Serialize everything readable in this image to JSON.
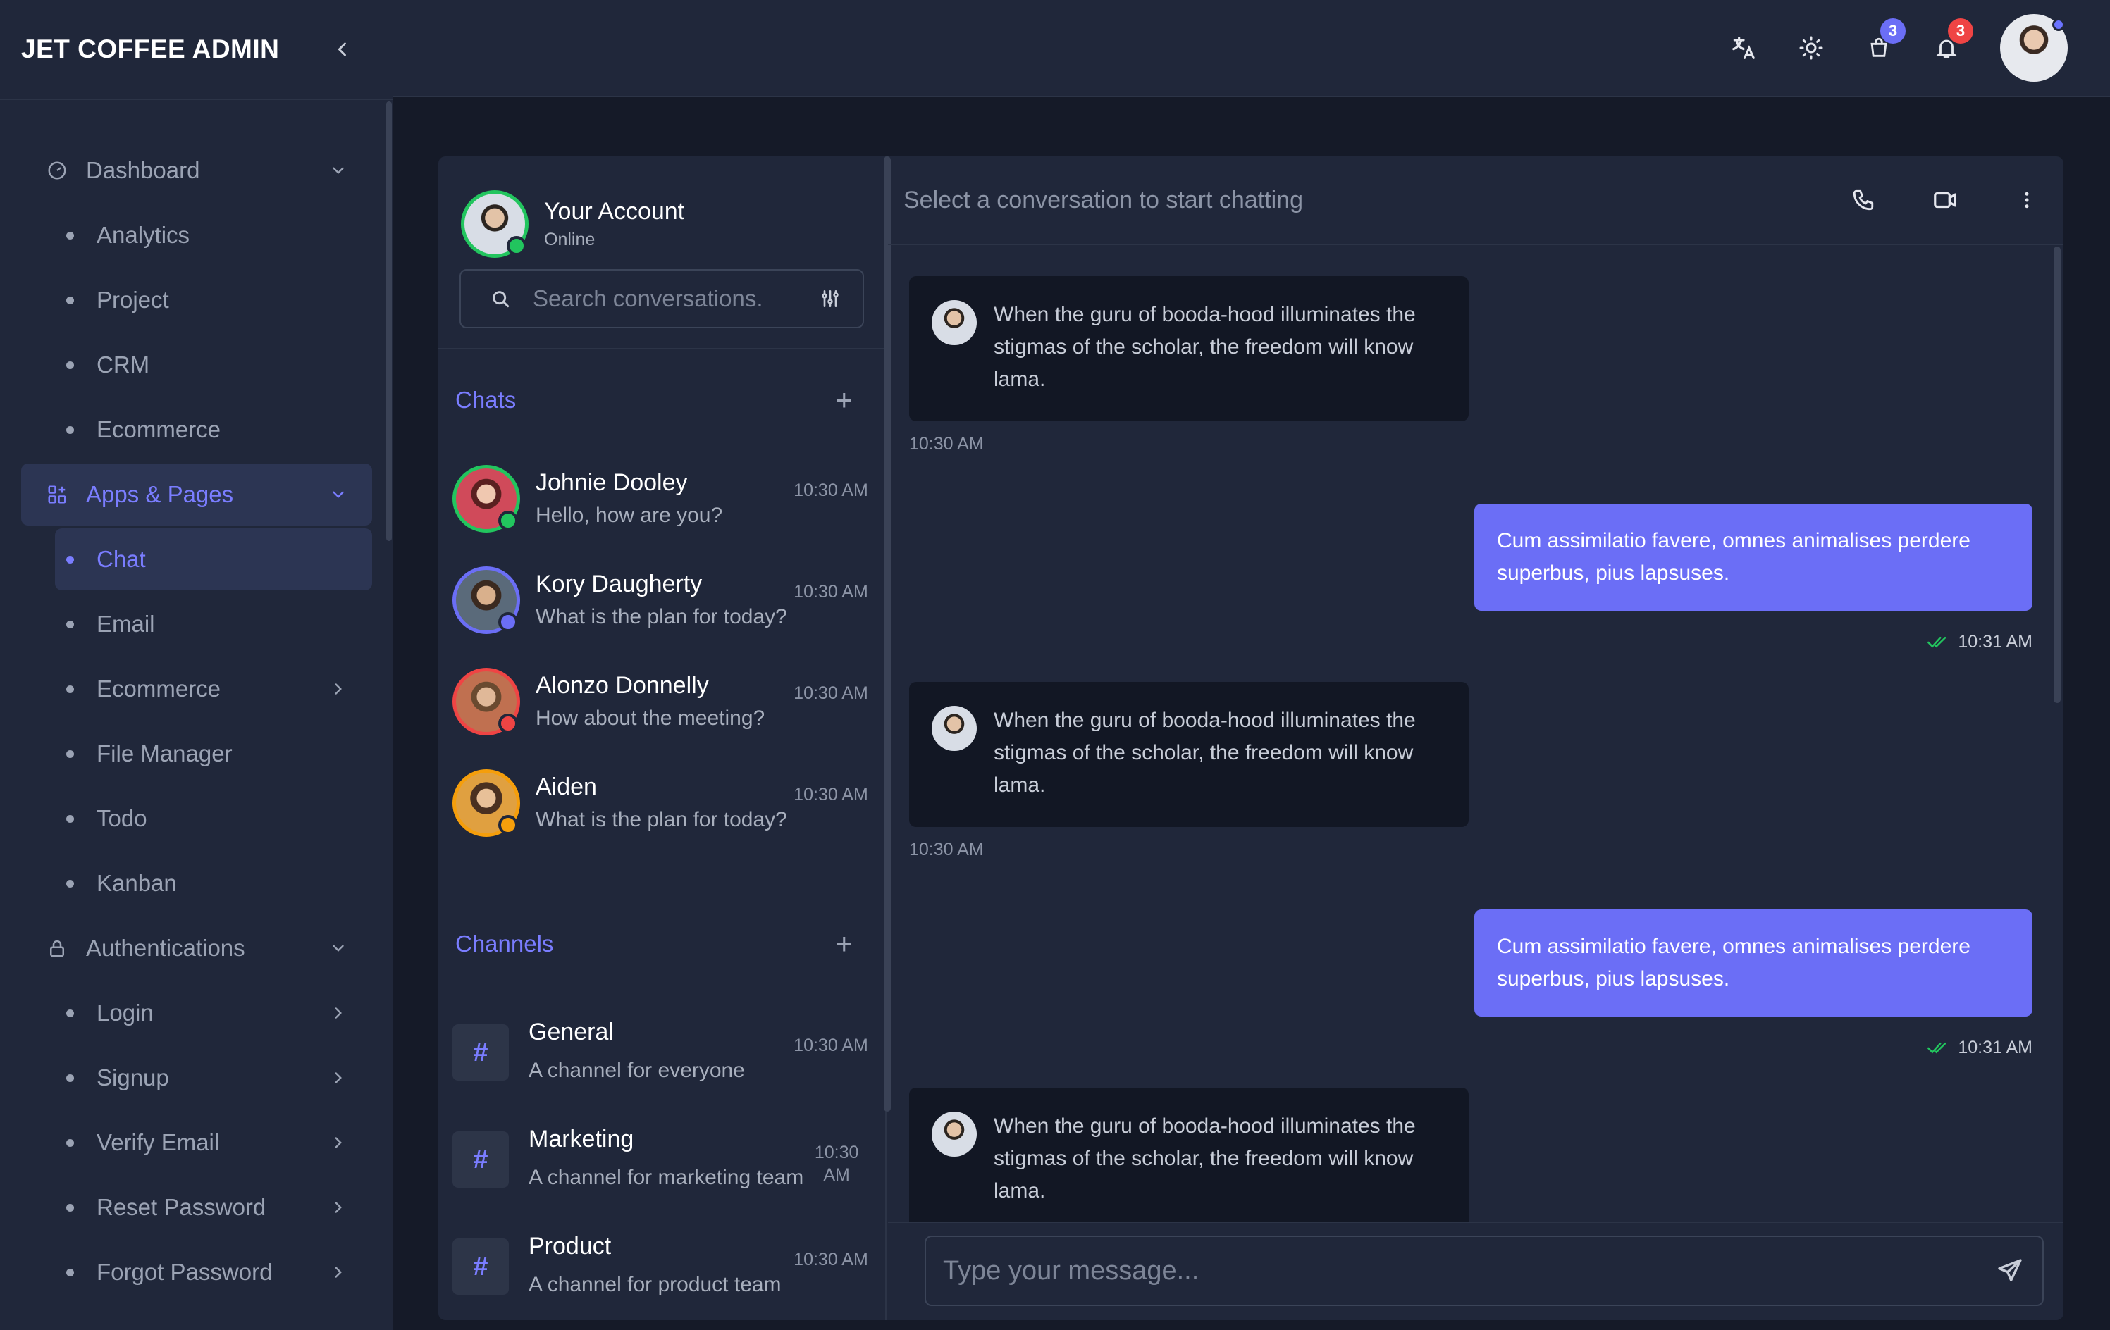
{
  "brand": {
    "title": "JET COFFEE ADMIN"
  },
  "sidebar": {
    "items": [
      {
        "type": "group",
        "label": "Dashboard",
        "icon": "gauge-icon",
        "expanded": true
      },
      {
        "type": "item",
        "label": "Analytics"
      },
      {
        "type": "item",
        "label": "Project"
      },
      {
        "type": "item",
        "label": "CRM"
      },
      {
        "type": "item",
        "label": "Ecommerce"
      },
      {
        "type": "group",
        "label": "Apps & Pages",
        "icon": "apps-icon",
        "active": true
      },
      {
        "type": "item",
        "label": "Chat",
        "active": true
      },
      {
        "type": "item",
        "label": "Email"
      },
      {
        "type": "item",
        "label": "Ecommerce",
        "chevron": true
      },
      {
        "type": "item",
        "label": "File Manager"
      },
      {
        "type": "item",
        "label": "Todo"
      },
      {
        "type": "item",
        "label": "Kanban"
      },
      {
        "type": "group",
        "label": "Authentications",
        "icon": "lock-icon"
      },
      {
        "type": "item",
        "label": "Login",
        "chevron": true
      },
      {
        "type": "item",
        "label": "Signup",
        "chevron": true
      },
      {
        "type": "item",
        "label": "Verify Email",
        "chevron": true
      },
      {
        "type": "item",
        "label": "Reset Password",
        "chevron": true
      },
      {
        "type": "item",
        "label": "Forgot Password",
        "chevron": true
      }
    ]
  },
  "topbar": {
    "cart_count": "3",
    "notification_count": "3",
    "colors": {
      "cart_badge": "#6b6ef6",
      "notification_badge": "#ef4444"
    }
  },
  "account": {
    "name": "Your Account",
    "status": "Online"
  },
  "search": {
    "placeholder": "Search conversations."
  },
  "chats": {
    "title": "Chats",
    "items": [
      {
        "name": "Johnie Dooley",
        "message": "Hello, how are you?",
        "time": "10:30 AM",
        "status_color": "#22c55e",
        "ring": "#22c55e"
      },
      {
        "name": "Kory Daugherty",
        "message": "What is the plan for today?",
        "time": "10:30 AM",
        "status_color": "#6b6ef6",
        "ring": "#6b6ef6"
      },
      {
        "name": "Alonzo Donnelly",
        "message": "How about the meeting?",
        "time": "10:30 AM",
        "status_color": "#ef4444",
        "ring": "#ef4444"
      },
      {
        "name": "Aiden",
        "message": "What is the plan for today?",
        "time": "10:30 AM",
        "status_color": "#f59e0b",
        "ring": "#f59e0b"
      }
    ]
  },
  "channels": {
    "title": "Channels",
    "items": [
      {
        "name": "General",
        "description": "A channel for everyone",
        "time": "10:30 AM"
      },
      {
        "name": "Marketing",
        "description": "A channel for marketing team",
        "time": "10:30 AM"
      },
      {
        "name": "Product",
        "description": "A channel for product team",
        "time": "10:30 AM"
      }
    ]
  },
  "conversation": {
    "header": "Select a conversation to start chatting",
    "messages": [
      {
        "dir": "in",
        "text": "When the guru of booda-hood illuminates the stigmas of the scholar, the freedom will know lama.",
        "time": "10:30 AM"
      },
      {
        "dir": "out",
        "text": "Cum assimilatio favere, omnes animalises perdere superbus, pius lapsuses.",
        "time": "10:31 AM"
      },
      {
        "dir": "in",
        "text": "When the guru of booda-hood illuminates the stigmas of the scholar, the freedom will know lama.",
        "time": "10:30 AM"
      },
      {
        "dir": "out",
        "text": "Cum assimilatio favere, omnes animalises perdere superbus, pius lapsuses.",
        "time": "10:31 AM"
      },
      {
        "dir": "in",
        "text": "When the guru of booda-hood illuminates the stigmas of the scholar, the freedom will know lama.",
        "time": ""
      }
    ],
    "composer_placeholder": "Type your message..."
  }
}
